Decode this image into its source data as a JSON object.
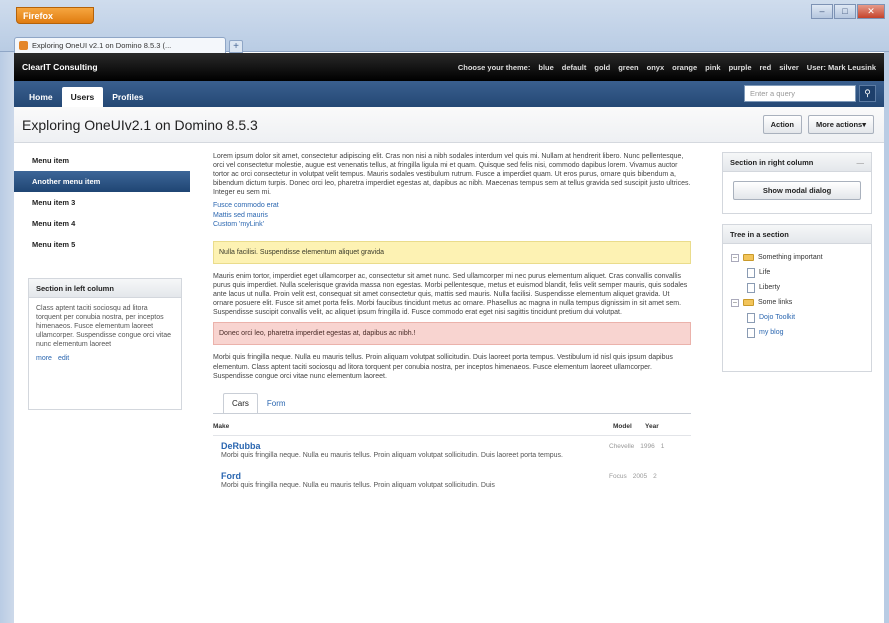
{
  "browser": {
    "menu_button": "Firefox",
    "tab_title": "Exploring OneUI v2.1 on Domino 8.5.3 (...",
    "new_tab": "+",
    "window_controls": [
      "–",
      "□",
      "✕"
    ]
  },
  "app": {
    "brand": "ClearIT Consulting",
    "theme_links": [
      "Choose your theme:",
      "blue",
      "default",
      "gold",
      "green",
      "onyx",
      "orange",
      "pink",
      "purple",
      "red",
      "silver",
      "User: Mark Leusink"
    ]
  },
  "nav": {
    "tabs": [
      "Home",
      "Users",
      "Profiles"
    ],
    "active_tab": 1,
    "search_placeholder": "Enter a query",
    "search_icon": "search-icon"
  },
  "page": {
    "title": "Exploring OneUIv2.1 on Domino 8.5.3",
    "actions": [
      "Action",
      "More actions▾"
    ]
  },
  "left": {
    "menu_items": [
      "Menu item",
      "Another menu item",
      "Menu item 3",
      "Menu item 4",
      "Menu item 5"
    ],
    "selected_index": 1,
    "section": {
      "title": "Section in left column",
      "body": "Class aptent taciti sociosqu ad litora torquent per conubia nostra, per inceptos himenaeos. Fusce elementum laoreet ullamcorper. Suspendisse congue orci vitae nunc elementum laoreet",
      "links": [
        "more",
        "edit"
      ]
    }
  },
  "main": {
    "intro": "Lorem ipsum dolor sit amet, consectetur adipiscing elit. Cras non nisi a nibh sodales interdum vel quis mi. Nullam at hendrerit libero. Nunc pellentesque, orci vel consectetur molestie, augue est venenatis tellus, at fringilla ligula mi et quam. Quisque sed felis nisi, commodo dapibus lorem. Vivamus auctor tortor ac orci consectetur in volutpat velit tempus. Mauris sodales vestibulum rutrum. Fusce a imperdiet quam. Ut eros purus, ornare quis bibendum a, bibendum dictum turpis. Donec orci leo, pharetra imperdiet egestas at, dapibus ac nibh. Maecenas tempus sem at tellus gravida sed suscipit justo ultrices. Integer eu sem mi.",
    "links": [
      "Fusce commodo erat",
      "Mattis sed mauris",
      "Custom 'myLink'"
    ],
    "warning": "Nulla facilisi. Suspendisse elementum aliquet gravida",
    "para2": "Mauris enim tortor, imperdiet eget ullamcorper ac, consectetur sit amet nunc. Sed ullamcorper mi nec purus elementum aliquet. Cras convallis convallis purus quis imperdiet. Nulla scelerisque gravida massa non egestas. Morbi pellentesque, metus et euismod blandit, felis velit semper mauris, quis sodales ante lacus ut nulla. Proin velit est, consequat sit amet consectetur quis, mattis sed mauris. Nulla facilisi. Suspendisse elementum aliquet gravida. Ut ornare posuere elit. Fusce sit amet porta felis. Morbi faucibus tincidunt metus ac ornare. Phasellus ac magna in nulla tempus dignissim in sit amet sem. Suspendisse suscipit convallis velit, ac aliquet ipsum fringilla id. Fusce commodo erat eget nisi sagittis tincidunt pretium dui volutpat.",
    "error": "Donec orci leo, pharetra imperdiet egestas at, dapibus ac nibh.!",
    "para3": "Morbi quis fringilla neque. Nulla eu mauris tellus. Proin aliquam volutpat sollicitudin. Duis laoreet porta tempus. Vestibulum id nisl quis ipsum dapibus elementum. Class aptent taciti sociosqu ad litora torquent per conubia nostra, per inceptos himenaeos. Fusce elementum laoreet ullamcorper. Suspendisse congue orci vitae nunc elementum laoreet.",
    "tabs": [
      "Cars",
      "Form"
    ],
    "active_tab": 0,
    "table_headers": [
      "Make",
      "Model",
      "Year"
    ],
    "cars": [
      {
        "name": "DeRubba",
        "desc": "Morbi quis fringilla neque. Nulla eu mauris tellus. Proin aliquam volutpat sollicitudin. Duis laoreet porta tempus.",
        "model": "Chevelle",
        "year": "1996",
        "rating": "1"
      },
      {
        "name": "Ford",
        "desc": "Morbi quis fringilla neque. Nulla eu mauris tellus. Proin aliquam volutpat sollicitudin. Duis",
        "model": "Focus",
        "year": "2005",
        "rating": "2"
      }
    ]
  },
  "right": {
    "section1": {
      "title": "Section in right column",
      "collapse": "—",
      "button": "Show modal dialog"
    },
    "section2": {
      "title": "Tree in a section",
      "nodes": [
        {
          "label": "Something important",
          "level": 1,
          "type": "folder"
        },
        {
          "label": "Life",
          "level": 2,
          "type": "doc"
        },
        {
          "label": "Liberty",
          "level": 2,
          "type": "doc"
        },
        {
          "label": "Some links",
          "level": 1,
          "type": "folder"
        },
        {
          "label": "Dojo Toolkit",
          "level": 2,
          "type": "link"
        },
        {
          "label": "my blog",
          "level": 2,
          "type": "link"
        }
      ]
    }
  }
}
